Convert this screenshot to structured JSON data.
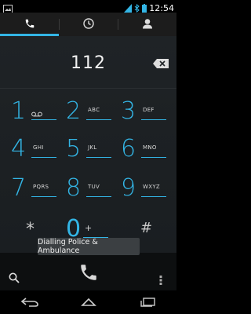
{
  "statusbar": {
    "time": "12:54"
  },
  "tabs": [
    {
      "name": "phone",
      "icon": "phone-icon",
      "active": true
    },
    {
      "name": "recents",
      "icon": "clock-icon",
      "active": false
    },
    {
      "name": "contacts",
      "icon": "person-icon",
      "active": false
    }
  ],
  "dialer": {
    "number": "112",
    "keys": [
      {
        "digit": "1",
        "letters": ""
      },
      {
        "digit": "2",
        "letters": "ABC"
      },
      {
        "digit": "3",
        "letters": "DEF"
      },
      {
        "digit": "4",
        "letters": "GHI"
      },
      {
        "digit": "5",
        "letters": "JKL"
      },
      {
        "digit": "6",
        "letters": "MNO"
      },
      {
        "digit": "7",
        "letters": "PQRS"
      },
      {
        "digit": "8",
        "letters": "TUV"
      },
      {
        "digit": "9",
        "letters": "WXYZ"
      },
      {
        "digit": "*",
        "letters": ""
      },
      {
        "digit": "0",
        "letters": "+"
      },
      {
        "digit": "#",
        "letters": ""
      }
    ]
  },
  "toast": {
    "text": "Dialling Police & Ambulance"
  },
  "colors": {
    "accent": "#33b5e5",
    "background": "#1f2326"
  }
}
